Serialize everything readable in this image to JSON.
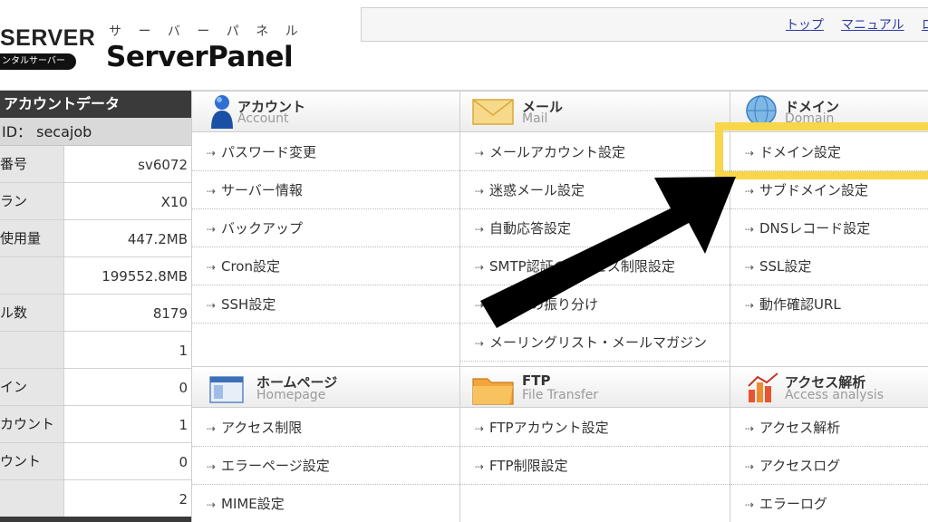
{
  "header": {
    "brand": "SERVER",
    "brand_pill": "ンタルサーバー",
    "product_kana": "サ ー バ ー パ ネ ル",
    "product_name": "ServerPanel",
    "links": [
      "トップ",
      "マニュアル",
      "ロ"
    ]
  },
  "account": {
    "title": "アカウントデータ",
    "id_row": "ID： secajob",
    "rows": [
      {
        "label": "番号",
        "value": "sv6072"
      },
      {
        "label": "ラン",
        "value": "X10"
      },
      {
        "label": "使用量",
        "value": "447.2MB"
      },
      {
        "label": "",
        "value": "199552.8MB"
      },
      {
        "label": "ル数",
        "value": "8179"
      },
      {
        "label": "",
        "value": "1"
      },
      {
        "label": "イン",
        "value": "0"
      },
      {
        "label": "カウント",
        "value": "1"
      },
      {
        "label": "ウント",
        "value": "0"
      },
      {
        "label": "",
        "value": "2"
      }
    ]
  },
  "sections": {
    "account": {
      "title": "アカウント",
      "subtitle": "Account",
      "icon": "person-icon",
      "items": [
        "パスワード変更",
        "サーバー情報",
        "バックアップ",
        "Cron設定",
        "SSH設定"
      ]
    },
    "mail": {
      "title": "メール",
      "subtitle": "Mail",
      "icon": "envelope-icon",
      "items": [
        "メールアカウント設定",
        "迷惑メール設定",
        "自動応答設定",
        "SMTP認証のアクセス制限設定",
        "メールの振り分け",
        "メーリングリスト・メールマガジン"
      ]
    },
    "domain": {
      "title": "ドメイン",
      "subtitle": "Domain",
      "icon": "globe-icon",
      "items": [
        "ドメイン設定",
        "サブドメイン設定",
        "DNSレコード設定",
        "SSL設定",
        "動作確認URL"
      ]
    },
    "homepage": {
      "title": "ホームページ",
      "subtitle": "Homepage",
      "icon": "homepage-icon",
      "items": [
        "アクセス制限",
        "エラーページ設定",
        "MIME設定"
      ]
    },
    "ftp": {
      "title": "FTP",
      "subtitle": "File Transfer",
      "icon": "folder-icon",
      "items": [
        "FTPアカウント設定",
        "FTP制限設定"
      ]
    },
    "access": {
      "title": "アクセス解析",
      "subtitle": "Access analysis",
      "icon": "chart-icon",
      "items": [
        "アクセス解析",
        "アクセスログ",
        "エラーログ"
      ]
    }
  },
  "colors": {
    "highlight": "#f7d64a",
    "arrow": "#000000",
    "link": "#2b3aa8",
    "account_header": "#3a3a3a"
  }
}
